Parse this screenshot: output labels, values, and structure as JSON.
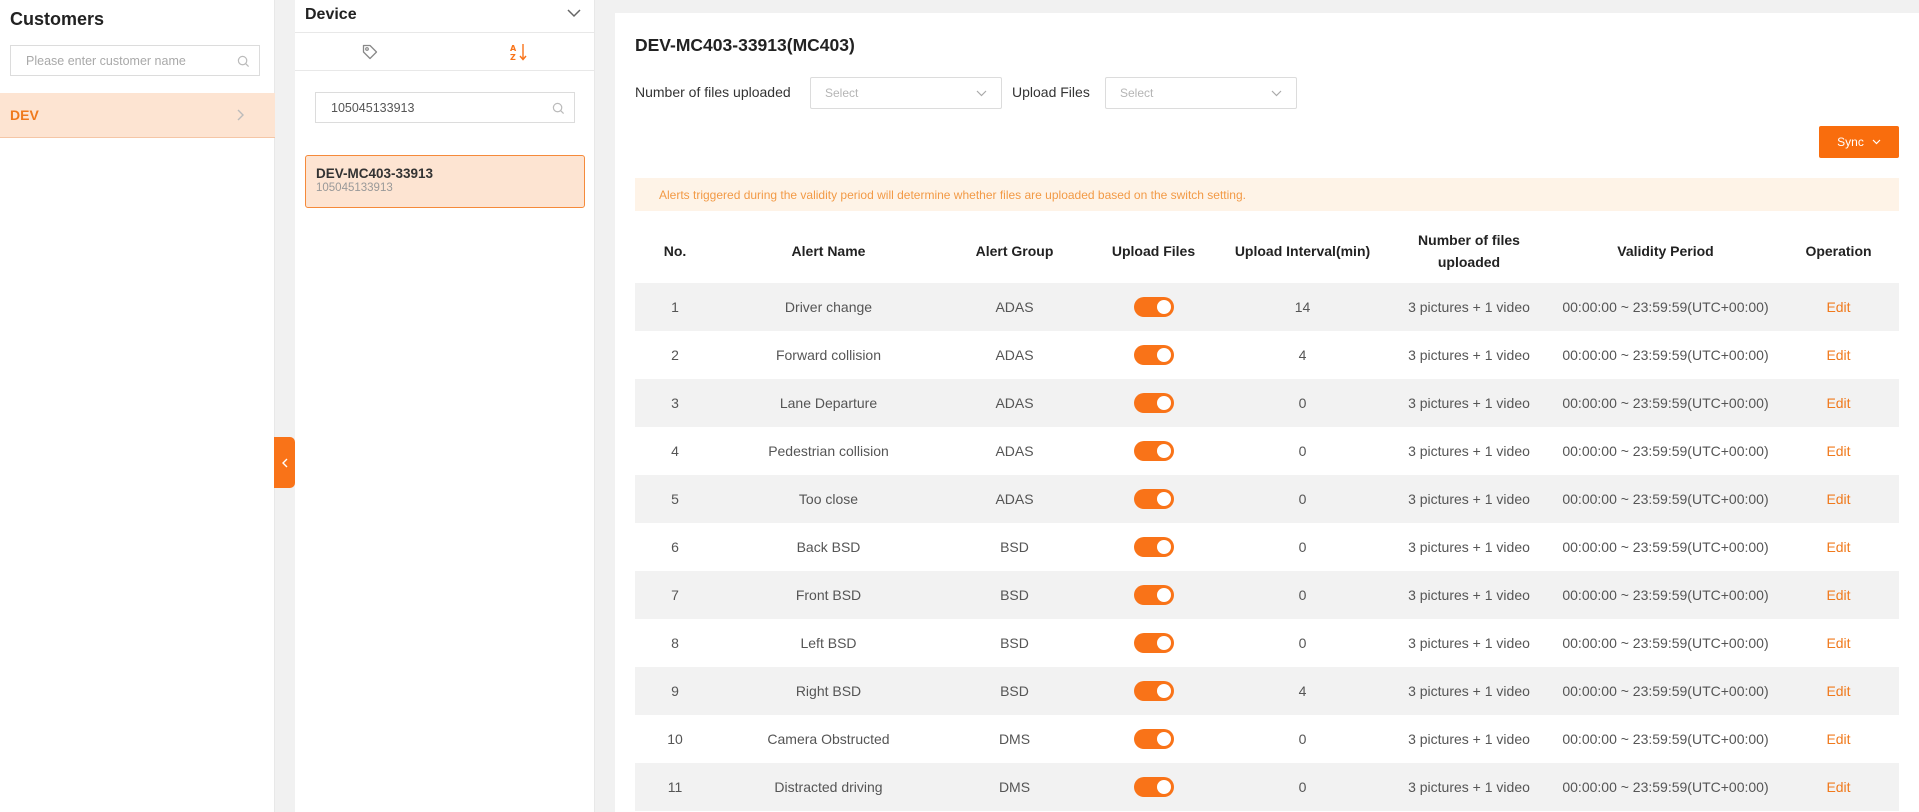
{
  "customers": {
    "title": "Customers",
    "search_placeholder": "Please enter customer name",
    "items": [
      {
        "label": "DEV"
      }
    ]
  },
  "device": {
    "title": "Device",
    "search_value": "105045133913",
    "tabs": [
      {
        "icon": "tag-icon"
      },
      {
        "icon": "sort-az-icon"
      }
    ],
    "cards": [
      {
        "name": "DEV-MC403-33913",
        "serial": "105045133913"
      }
    ]
  },
  "main": {
    "title": "DEV-MC403-33913(MC403)",
    "filters": {
      "files_uploaded_label": "Number of files uploaded",
      "files_uploaded_placeholder": "Select",
      "upload_files_label": "Upload Files",
      "upload_files_placeholder": "Select"
    },
    "sync_label": "Sync",
    "notice": "Alerts triggered during the validity period will determine whether files are uploaded based on the switch setting.",
    "table": {
      "headers": {
        "no": "No.",
        "alert_name": "Alert Name",
        "alert_group": "Alert Group",
        "upload_files": "Upload Files",
        "upload_interval": "Upload Interval(min)",
        "files_count_line1": "Number of files",
        "files_count_line2": "uploaded",
        "validity": "Validity Period",
        "operation": "Operation"
      },
      "rows": [
        {
          "no": "1",
          "name": "Driver change",
          "group": "ADAS",
          "upload": true,
          "interval": "14",
          "files": "3 pictures + 1 video",
          "validity": "00:00:00 ~ 23:59:59(UTC+00:00)",
          "op": "Edit"
        },
        {
          "no": "2",
          "name": "Forward collision",
          "group": "ADAS",
          "upload": true,
          "interval": "4",
          "files": "3 pictures + 1 video",
          "validity": "00:00:00 ~ 23:59:59(UTC+00:00)",
          "op": "Edit"
        },
        {
          "no": "3",
          "name": "Lane Departure",
          "group": "ADAS",
          "upload": true,
          "interval": "0",
          "files": "3 pictures + 1 video",
          "validity": "00:00:00 ~ 23:59:59(UTC+00:00)",
          "op": "Edit"
        },
        {
          "no": "4",
          "name": "Pedestrian collision",
          "group": "ADAS",
          "upload": true,
          "interval": "0",
          "files": "3 pictures + 1 video",
          "validity": "00:00:00 ~ 23:59:59(UTC+00:00)",
          "op": "Edit"
        },
        {
          "no": "5",
          "name": "Too close",
          "group": "ADAS",
          "upload": true,
          "interval": "0",
          "files": "3 pictures + 1 video",
          "validity": "00:00:00 ~ 23:59:59(UTC+00:00)",
          "op": "Edit"
        },
        {
          "no": "6",
          "name": "Back BSD",
          "group": "BSD",
          "upload": true,
          "interval": "0",
          "files": "3 pictures + 1 video",
          "validity": "00:00:00 ~ 23:59:59(UTC+00:00)",
          "op": "Edit"
        },
        {
          "no": "7",
          "name": "Front BSD",
          "group": "BSD",
          "upload": true,
          "interval": "0",
          "files": "3 pictures + 1 video",
          "validity": "00:00:00 ~ 23:59:59(UTC+00:00)",
          "op": "Edit"
        },
        {
          "no": "8",
          "name": "Left BSD",
          "group": "BSD",
          "upload": true,
          "interval": "0",
          "files": "3 pictures + 1 video",
          "validity": "00:00:00 ~ 23:59:59(UTC+00:00)",
          "op": "Edit"
        },
        {
          "no": "9",
          "name": "Right BSD",
          "group": "BSD",
          "upload": true,
          "interval": "4",
          "files": "3 pictures + 1 video",
          "validity": "00:00:00 ~ 23:59:59(UTC+00:00)",
          "op": "Edit"
        },
        {
          "no": "10",
          "name": "Camera Obstructed",
          "group": "DMS",
          "upload": true,
          "interval": "0",
          "files": "3 pictures + 1 video",
          "validity": "00:00:00 ~ 23:59:59(UTC+00:00)",
          "op": "Edit"
        },
        {
          "no": "11",
          "name": "Distracted driving",
          "group": "DMS",
          "upload": true,
          "interval": "0",
          "files": "3 pictures + 1 video",
          "validity": "00:00:00 ~ 23:59:59(UTC+00:00)",
          "op": "Edit"
        }
      ]
    }
  },
  "colors": {
    "accent": "#f97318",
    "accent_light": "#fde4d2",
    "notice_bg": "#fef3e7",
    "row_alt": "#f2f2f2"
  }
}
